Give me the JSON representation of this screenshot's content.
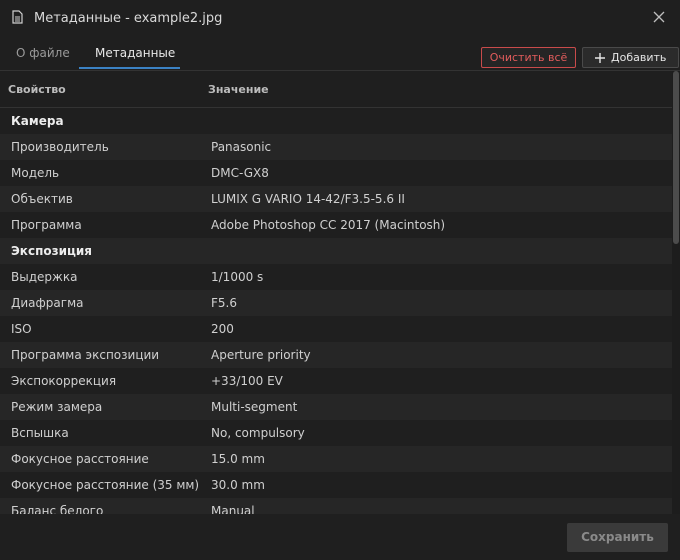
{
  "window": {
    "title": "Метаданные - example2.jpg"
  },
  "tabs": [
    {
      "label": "О файле",
      "active": false
    },
    {
      "label": "Метаданные",
      "active": true
    }
  ],
  "actions": {
    "clear_label": "Очистить всё",
    "add_label": "Добавить"
  },
  "table": {
    "columns": [
      "Свойство",
      "Значение"
    ],
    "rows": [
      {
        "group": true,
        "key": "Камера",
        "value": ""
      },
      {
        "key": "Производитель",
        "value": "Panasonic"
      },
      {
        "key": "Модель",
        "value": "DMC-GX8"
      },
      {
        "key": "Объектив",
        "value": "LUMIX G VARIO 14-42/F3.5-5.6 II"
      },
      {
        "key": "Программа",
        "value": "Adobe Photoshop CC 2017 (Macintosh)"
      },
      {
        "group": true,
        "key": "Экспозиция",
        "value": ""
      },
      {
        "key": "Выдержка",
        "value": "1/1000 s"
      },
      {
        "key": "Диафрагма",
        "value": "F5.6"
      },
      {
        "key": "ISO",
        "value": "200"
      },
      {
        "key": "Программа экспозиции",
        "value": "Aperture priority"
      },
      {
        "key": "Экспокоррекция",
        "value": "+33/100 EV"
      },
      {
        "key": "Режим замера",
        "value": "Multi-segment"
      },
      {
        "key": "Вспышка",
        "value": "No, compulsory"
      },
      {
        "key": "Фокусное расстояние",
        "value": "15.0 mm"
      },
      {
        "key": "Фокусное расстояние (35 мм)",
        "value": "30.0 mm"
      },
      {
        "key": "Баланс белого",
        "value": "Manual"
      }
    ]
  },
  "footer": {
    "save_label": "Сохранить"
  },
  "colors": {
    "accent": "#3b82c4",
    "danger": "#e25c5c",
    "background": "#1f1f1f"
  },
  "icons": {
    "title": "document-icon",
    "close": "close-icon",
    "add": "plus-icon"
  }
}
